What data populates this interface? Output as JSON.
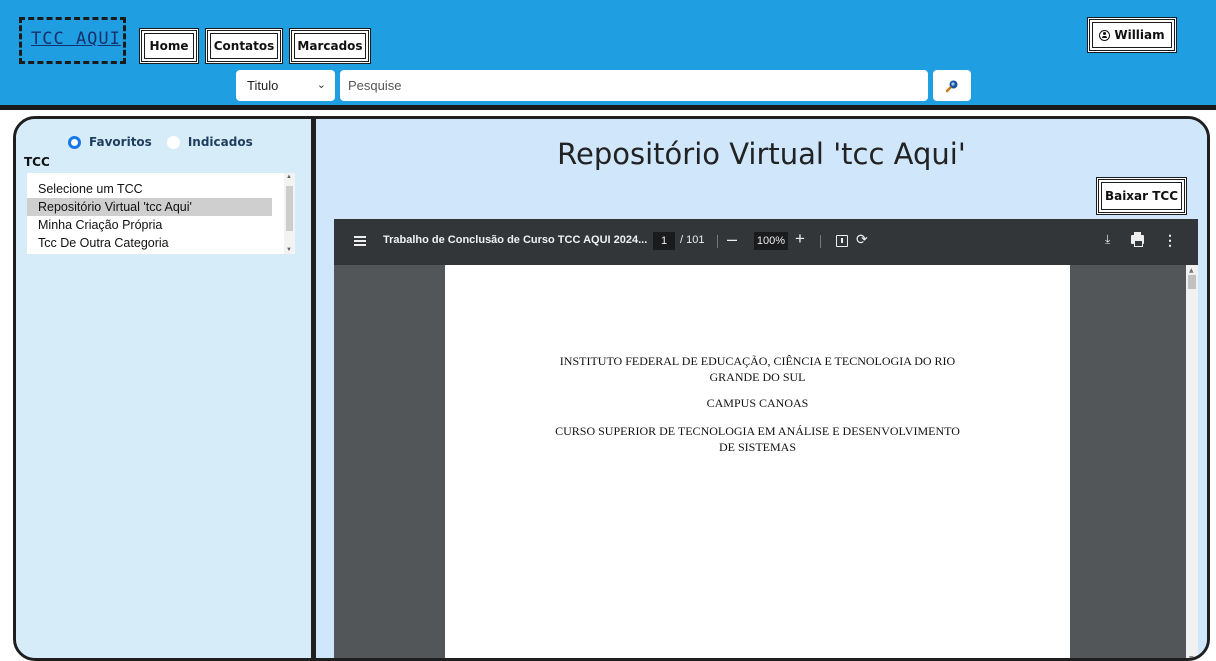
{
  "header": {
    "logo_text": "TCC AQUI",
    "nav": {
      "home": "Home",
      "contatos": "Contatos",
      "marcados": "Marcados"
    },
    "user_label": "William",
    "search": {
      "field_select": "Titulo",
      "placeholder": "Pesquise"
    },
    "colors": {
      "bar": "#1f9fe2"
    }
  },
  "sidebar": {
    "radio_favoritos": "Favoritos",
    "radio_indicados": "Indicados",
    "radio_selected": "Favoritos",
    "list_label": "TCC",
    "items": [
      "Selecione um TCC",
      "Repositório Virtual 'tcc Aqui'",
      "Minha Criação Própria",
      "Tcc De Outra Categoria"
    ],
    "selected_index": 1
  },
  "main": {
    "title": "Repositório Virtual 'tcc Aqui'",
    "download_button": "Baixar TCC",
    "pdf": {
      "document_title": "Trabalho de Conclusão de Curso TCC AQUI 2024...",
      "current_page": "1",
      "total_pages": "/ 101",
      "zoom": "100%",
      "lines": [
        "INSTITUTO FEDERAL DE EDUCAÇÃO, CIÊNCIA E TECNOLOGIA DO RIO",
        "GRANDE DO SUL",
        "CAMPUS CANOAS",
        "CURSO SUPERIOR DE TECNOLOGIA EM ANÁLISE E DESENVOLVIMENTO",
        "DE SISTEMAS"
      ]
    }
  }
}
